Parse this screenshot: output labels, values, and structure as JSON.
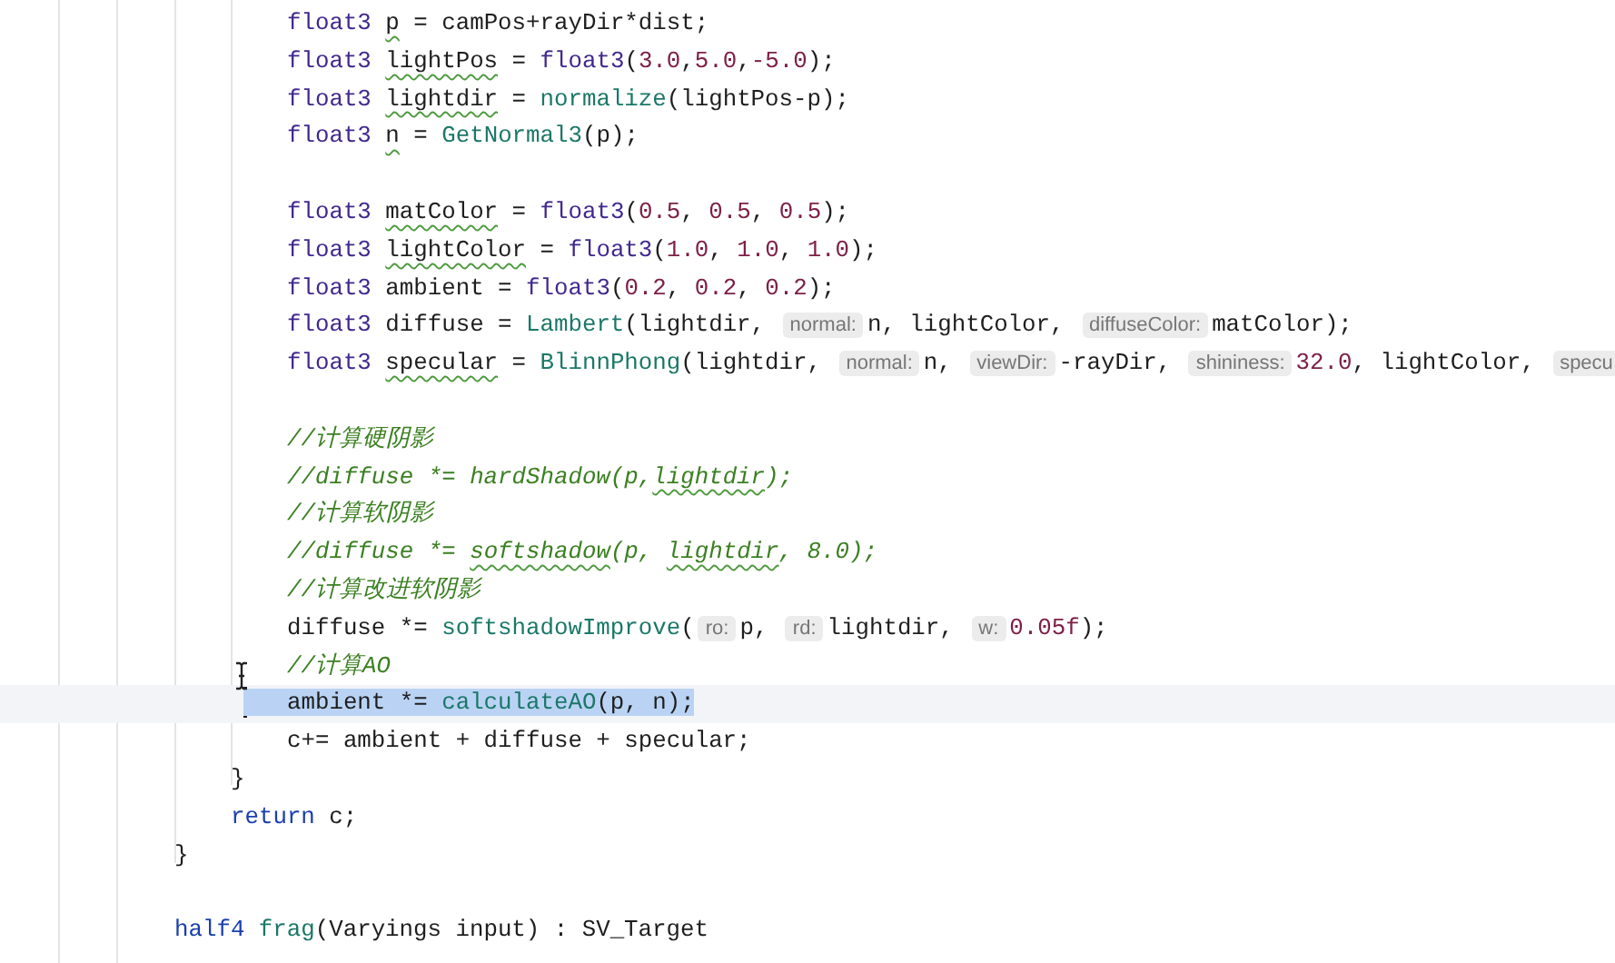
{
  "editor": {
    "lines": [
      {
        "children": [
          {
            "children": [
              {
                "selected": false,
                "tokens": [
                  {
                    "kind": "kw",
                    "text": "float3 "
                  },
                  {
                    "kind": "text",
                    "text": "p",
                    "warn": true
                  },
                  {
                    "kind": "text",
                    "text": " = camPos+rayDir*dist;"
                  }
                ]
              },
              {
                "selected": false,
                "tokens": [
                  {
                    "kind": "kw",
                    "text": "float3 "
                  },
                  {
                    "kind": "text",
                    "text": "lightPos",
                    "warn": true
                  },
                  {
                    "kind": "text",
                    "text": " = "
                  },
                  {
                    "kind": "kw",
                    "text": "float3"
                  },
                  {
                    "kind": "text",
                    "text": "("
                  },
                  {
                    "kind": "num",
                    "text": "3.0"
                  },
                  {
                    "kind": "text",
                    "text": ","
                  },
                  {
                    "kind": "num",
                    "text": "5.0"
                  },
                  {
                    "kind": "text",
                    "text": ","
                  },
                  {
                    "kind": "num",
                    "text": "-5.0"
                  },
                  {
                    "kind": "text",
                    "text": ");"
                  }
                ]
              },
              {
                "selected": false,
                "tokens": [
                  {
                    "kind": "kw",
                    "text": "float3 "
                  },
                  {
                    "kind": "text",
                    "text": "lightdir",
                    "warn": true
                  },
                  {
                    "kind": "text",
                    "text": " = "
                  },
                  {
                    "kind": "fn",
                    "text": "normalize"
                  },
                  {
                    "kind": "text",
                    "text": "(lightPos-p);"
                  }
                ]
              },
              {
                "selected": false,
                "tokens": [
                  {
                    "kind": "kw",
                    "text": "float3 "
                  },
                  {
                    "kind": "text",
                    "text": "n",
                    "warn": true
                  },
                  {
                    "kind": "text",
                    "text": " = "
                  },
                  {
                    "kind": "fn",
                    "text": "GetNormal3"
                  },
                  {
                    "kind": "text",
                    "text": "(p);"
                  }
                ]
              },
              {
                "selected": false
              },
              {
                "selected": false,
                "tokens": [
                  {
                    "kind": "kw",
                    "text": "float3 "
                  },
                  {
                    "kind": "text",
                    "text": "matColor",
                    "warn": true
                  },
                  {
                    "kind": "text",
                    "text": " = "
                  },
                  {
                    "kind": "kw",
                    "text": "float3"
                  },
                  {
                    "kind": "text",
                    "text": "("
                  },
                  {
                    "kind": "num",
                    "text": "0.5"
                  },
                  {
                    "kind": "text",
                    "text": ", "
                  },
                  {
                    "kind": "num",
                    "text": "0.5"
                  },
                  {
                    "kind": "text",
                    "text": ", "
                  },
                  {
                    "kind": "num",
                    "text": "0.5"
                  },
                  {
                    "kind": "text",
                    "text": ");"
                  }
                ]
              },
              {
                "selected": false,
                "tokens": [
                  {
                    "kind": "kw",
                    "text": "float3 "
                  },
                  {
                    "kind": "text",
                    "text": "lightColor",
                    "warn": true
                  },
                  {
                    "kind": "text",
                    "text": " = "
                  },
                  {
                    "kind": "kw",
                    "text": "float3"
                  },
                  {
                    "kind": "text",
                    "text": "("
                  },
                  {
                    "kind": "num",
                    "text": "1.0"
                  },
                  {
                    "kind": "text",
                    "text": ", "
                  },
                  {
                    "kind": "num",
                    "text": "1.0"
                  },
                  {
                    "kind": "text",
                    "text": ", "
                  },
                  {
                    "kind": "num",
                    "text": "1.0"
                  },
                  {
                    "kind": "text",
                    "text": ");"
                  }
                ]
              },
              {
                "selected": false,
                "tokens": [
                  {
                    "kind": "kw",
                    "text": "float3"
                  },
                  {
                    "kind": "text",
                    "text": " ambient = "
                  },
                  {
                    "kind": "kw",
                    "text": "float3"
                  },
                  {
                    "kind": "text",
                    "text": "("
                  },
                  {
                    "kind": "num",
                    "text": "0.2"
                  },
                  {
                    "kind": "text",
                    "text": ", "
                  },
                  {
                    "kind": "num",
                    "text": "0.2"
                  },
                  {
                    "kind": "text",
                    "text": ", "
                  },
                  {
                    "kind": "num",
                    "text": "0.2"
                  },
                  {
                    "kind": "text",
                    "text": ");"
                  }
                ]
              },
              {
                "selected": false,
                "tokens": [
                  {
                    "kind": "kw",
                    "text": "float3"
                  },
                  {
                    "kind": "text",
                    "text": " diffuse = "
                  },
                  {
                    "kind": "fn",
                    "text": "Lambert"
                  },
                  {
                    "kind": "text",
                    "text": "(lightdir, "
                  },
                  {
                    "kind": "hint",
                    "text": "normal:"
                  },
                  {
                    "kind": "text",
                    "text": "n, lightColor, "
                  },
                  {
                    "kind": "hint",
                    "text": "diffuseColor:"
                  },
                  {
                    "kind": "text",
                    "text": "matColor);"
                  }
                ]
              },
              {
                "selected": false,
                "tokens": [
                  {
                    "kind": "kw",
                    "text": "float3 "
                  },
                  {
                    "kind": "text",
                    "text": "specular",
                    "warn": true
                  },
                  {
                    "kind": "text",
                    "text": " = "
                  },
                  {
                    "kind": "fn",
                    "text": "BlinnPhong"
                  },
                  {
                    "kind": "text",
                    "text": "(lightdir, "
                  },
                  {
                    "kind": "hint",
                    "text": "normal:"
                  },
                  {
                    "kind": "text",
                    "text": "n, "
                  },
                  {
                    "kind": "hint",
                    "text": "viewDir:"
                  },
                  {
                    "kind": "text",
                    "text": "-rayDir, "
                  },
                  {
                    "kind": "hint",
                    "text": "shininess:"
                  },
                  {
                    "kind": "num",
                    "text": "32.0"
                  },
                  {
                    "kind": "text",
                    "text": ", lightColor, "
                  },
                  {
                    "kind": "hint",
                    "text": "specu"
                  }
                ]
              },
              {
                "selected": false
              },
              {
                "selected": false,
                "tokens": [
                  {
                    "kind": "comment",
                    "text": "//计算硬阴影"
                  }
                ]
              },
              {
                "selected": false,
                "tokens": [
                  {
                    "kind": "comment",
                    "text": "//diffuse *= hardShadow(p,"
                  },
                  {
                    "kind": "comment",
                    "text": "lightdir",
                    "warn": true
                  },
                  {
                    "kind": "comment",
                    "text": ");"
                  }
                ]
              },
              {
                "selected": false,
                "tokens": [
                  {
                    "kind": "comment",
                    "text": "//计算软阴影"
                  }
                ]
              },
              {
                "selected": false,
                "tokens": [
                  {
                    "kind": "comment",
                    "text": "//diffuse *= "
                  },
                  {
                    "kind": "comment",
                    "text": "softshadow",
                    "warn": true
                  },
                  {
                    "kind": "comment",
                    "text": "(p, "
                  },
                  {
                    "kind": "comment",
                    "text": "lightdir",
                    "warn": true
                  },
                  {
                    "kind": "comment",
                    "text": ", 8.0);"
                  }
                ]
              },
              {
                "selected": false,
                "tokens": [
                  {
                    "kind": "comment",
                    "text": "//计算改进软阴影"
                  }
                ]
              },
              {
                "selected": false,
                "tokens": [
                  {
                    "kind": "text",
                    "text": "diffuse *= "
                  },
                  {
                    "kind": "fn",
                    "text": "softshadowImprove"
                  },
                  {
                    "kind": "text",
                    "text": "("
                  },
                  {
                    "kind": "hint",
                    "text": "ro:"
                  },
                  {
                    "kind": "text",
                    "text": "p, "
                  },
                  {
                    "kind": "hint",
                    "text": "rd:"
                  },
                  {
                    "kind": "text",
                    "text": "lightdir, "
                  },
                  {
                    "kind": "hint",
                    "text": "w:"
                  },
                  {
                    "kind": "num",
                    "text": "0.05f"
                  },
                  {
                    "kind": "text",
                    "text": ");"
                  }
                ]
              },
              {
                "selected": false,
                "tokens": [
                  {
                    "kind": "comment",
                    "text": "//计算AO"
                  }
                ]
              },
              {
                "selected": true,
                "tokens": [
                  {
                    "kind": "text",
                    "text": "ambient *= "
                  },
                  {
                    "kind": "fn",
                    "text": "calculateAO"
                  },
                  {
                    "kind": "text",
                    "text": "(p, n);"
                  }
                ]
              },
              {
                "selected": false,
                "tokens": [
                  {
                    "kind": "text",
                    "text": "c+= ambient + diffuse + specular;"
                  }
                ]
              }
            ]
          },
          {
            "selected": false,
            "tokens": [
              {
                "kind": "text",
                "text": "}"
              }
            ]
          },
          {
            "selected": false,
            "tokens": [
              {
                "kind": "kw2",
                "text": "return"
              },
              {
                "kind": "text",
                "text": " c;"
              }
            ]
          }
        ]
      },
      {
        "selected": false,
        "tokens": [
          {
            "kind": "text",
            "text": "}"
          }
        ]
      },
      {
        "selected": false
      },
      {
        "selected": false,
        "tokens": [
          {
            "kind": "kw2",
            "text": "half4 "
          },
          {
            "kind": "fn",
            "text": "frag"
          },
          {
            "kind": "text",
            "text": "(Varyings input) : SV_Target"
          }
        ]
      }
    ]
  }
}
